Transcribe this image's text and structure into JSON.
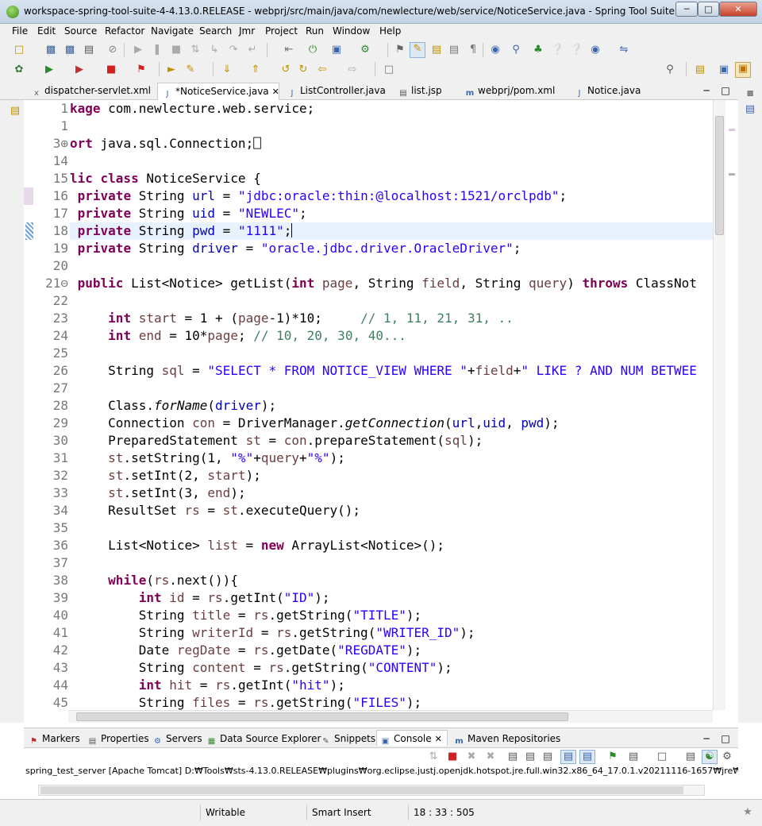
{
  "window": {
    "title": "workspace-spring-tool-suite-4-4.13.0.RELEASE - webprj/src/main/java/com/newlecture/web/service/NoticeService.java - Spring Tool Suite 4",
    "min": "─",
    "max": "□",
    "close": "✕"
  },
  "menu": [
    "File",
    "Edit",
    "Source",
    "Refactor",
    "Navigate",
    "Search",
    "Jmr",
    "Project",
    "Run",
    "Window",
    "Help"
  ],
  "tabs": [
    {
      "label": "dispatcher-servlet.xml",
      "icon": "x"
    },
    {
      "label": "*NoticeService.java",
      "icon": "J",
      "active": true,
      "close": "✕"
    },
    {
      "label": "ListController.java",
      "icon": "J"
    },
    {
      "label": "list.jsp",
      "icon": "▤"
    },
    {
      "label": "webprj/pom.xml",
      "icon": "m"
    },
    {
      "label": "Notice.java",
      "icon": "J"
    }
  ],
  "editor": {
    "lines": [
      {
        "n": "1",
        "html": "<span class=\"kw\">kage</span> com.newlecture.web.service;"
      },
      {
        "n": "1",
        "html": ""
      },
      {
        "n": "3⊕",
        "html": "<span class=\"kw\">ort</span> java.sql.Connection;⎕"
      },
      {
        "n": "14",
        "html": ""
      },
      {
        "n": "15",
        "html": "<span class=\"kw\">lic class</span> NoticeService {"
      },
      {
        "n": "16",
        "html": " <span class=\"kw\">private</span> String <span class=\"fld\">url</span> = <span class=\"str\">\"jdbc:oracle:thin:@localhost:1521/orclpdb\"</span>;"
      },
      {
        "n": "17",
        "html": " <span class=\"kw\">private</span> String <span class=\"fld\">uid</span> = <span class=\"str\">\"NEWLEC\"</span>;"
      },
      {
        "n": "18",
        "html": " <span class=\"kw\">private</span> String <span class=\"fld\">pwd</span> = <span class=\"str\">\"1111\"</span>;<span class=\"cursor\"></span>",
        "current": true
      },
      {
        "n": "19",
        "html": " <span class=\"kw\">private</span> String <span class=\"fld\">driver</span> = <span class=\"str\">\"oracle.jdbc.driver.OracleDriver\"</span>;"
      },
      {
        "n": "20",
        "html": ""
      },
      {
        "n": "21⊖",
        "html": " <span class=\"kw\">public</span> List&lt;Notice&gt; getList(<span class=\"kw\">int</span> <span class=\"var\">page</span>, String <span class=\"var\">field</span>, String <span class=\"var\">query</span>) <span class=\"kw\">throws</span> ClassNot"
      },
      {
        "n": "22",
        "html": ""
      },
      {
        "n": "23",
        "html": "     <span class=\"kw\">int</span> <span class=\"var\">start</span> = 1 + (<span class=\"var\">page</span>-1)*10;     <span class=\"cmt\">// 1, 11, 21, 31, ..</span>"
      },
      {
        "n": "24",
        "html": "     <span class=\"kw\">int</span> <span class=\"var\">end</span> = 10*<span class=\"var\">page</span>; <span class=\"cmt\">// 10, 20, 30, 40...</span>"
      },
      {
        "n": "25",
        "html": ""
      },
      {
        "n": "26",
        "html": "     String <span class=\"var\">sql</span> = <span class=\"str\">\"SELECT * FROM NOTICE_VIEW WHERE \"</span>+<span class=\"var\">field</span>+<span class=\"str\">\" LIKE ? AND NUM BETWEE</span>"
      },
      {
        "n": "27",
        "html": ""
      },
      {
        "n": "28",
        "html": "     Class.<span class=\"ital\">forName</span>(<span class=\"fld\">driver</span>);"
      },
      {
        "n": "29",
        "html": "     Connection <span class=\"var\">con</span> = DriverManager.<span class=\"ital\">getConnection</span>(<span class=\"fld\">url</span>,<span class=\"fld\">uid</span>, <span class=\"fld\">pwd</span>);"
      },
      {
        "n": "30",
        "html": "     PreparedStatement <span class=\"var\">st</span> = <span class=\"var\">con</span>.prepareStatement(<span class=\"var\">sql</span>);"
      },
      {
        "n": "31",
        "html": "     <span class=\"var\">st</span>.setString(1, <span class=\"str\">\"%\"</span>+<span class=\"var\">query</span>+<span class=\"str\">\"%\"</span>);"
      },
      {
        "n": "32",
        "html": "     <span class=\"var\">st</span>.setInt(2, <span class=\"var\">start</span>);"
      },
      {
        "n": "33",
        "html": "     <span class=\"var\">st</span>.setInt(3, <span class=\"var\">end</span>);"
      },
      {
        "n": "34",
        "html": "     ResultSet <span class=\"var\">rs</span> = <span class=\"var\">st</span>.executeQuery();"
      },
      {
        "n": "35",
        "html": ""
      },
      {
        "n": "36",
        "html": "     List&lt;Notice&gt; <span class=\"var\">list</span> = <span class=\"kw\">new</span> ArrayList&lt;Notice&gt;();"
      },
      {
        "n": "37",
        "html": ""
      },
      {
        "n": "38",
        "html": "     <span class=\"kw\">while</span>(<span class=\"var\">rs</span>.next()){"
      },
      {
        "n": "39",
        "html": "         <span class=\"kw\">int</span> <span class=\"var\">id</span> = <span class=\"var\">rs</span>.getInt(<span class=\"str\">\"ID\"</span>);"
      },
      {
        "n": "40",
        "html": "         String <span class=\"var\">title</span> = <span class=\"var\">rs</span>.getString(<span class=\"str\">\"TITLE\"</span>);"
      },
      {
        "n": "41",
        "html": "         String <span class=\"var\">writerId</span> = <span class=\"var\">rs</span>.getString(<span class=\"str\">\"WRITER_ID\"</span>);"
      },
      {
        "n": "42",
        "html": "         Date <span class=\"var\">regDate</span> = <span class=\"var\">rs</span>.getDate(<span class=\"str\">\"REGDATE\"</span>);"
      },
      {
        "n": "43",
        "html": "         String <span class=\"var\">content</span> = <span class=\"var\">rs</span>.getString(<span class=\"str\">\"CONTENT\"</span>);"
      },
      {
        "n": "44",
        "html": "         <span class=\"kw\">int</span> <span class=\"var\">hit</span> = <span class=\"var\">rs</span>.getInt(<span class=\"str\">\"hit\"</span>);"
      },
      {
        "n": "45",
        "html": "         String <span class=\"var\">files</span> = <span class=\"var\">rs</span>.getString(<span class=\"str\">\"FILES\"</span>);"
      }
    ]
  },
  "views": [
    {
      "label": "Markers",
      "icon": "⚑"
    },
    {
      "label": "Properties",
      "icon": "▤"
    },
    {
      "label": "Servers",
      "icon": "⚙"
    },
    {
      "label": "Data Source Explorer",
      "icon": "▦"
    },
    {
      "label": "Snippets",
      "icon": "✎"
    },
    {
      "label": "Console",
      "icon": "▣",
      "active": true,
      "close": "✕"
    },
    {
      "label": "Maven Repositories",
      "icon": "m"
    }
  ],
  "console": {
    "process": "spring_test_server [Apache Tomcat] D:₩Tools₩sts-4.13.0.RELEASE₩plugins₩org.eclipse.justj.openjdk.hotspot.jre.full.win32.x86_64_17.0.1.v20211116-1657₩jre₩bin₩ja"
  },
  "status": {
    "writable": "Writable",
    "insert_mode": "Smart Insert",
    "position": "18 : 33 : 505"
  },
  "colors": {
    "keyword": "#7f0055",
    "string": "#2a00ff",
    "field": "#0000c0",
    "comment": "#3f7f5f",
    "current_line": "#e8f2fe"
  }
}
